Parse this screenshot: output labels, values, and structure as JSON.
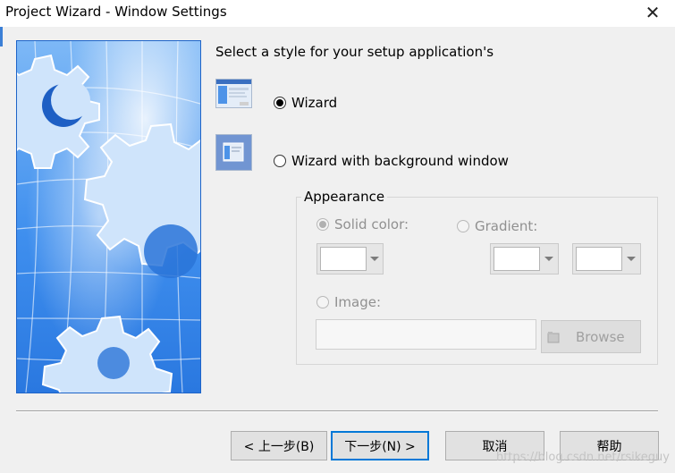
{
  "window": {
    "title": "Project Wizard - Window Settings",
    "close_glyph": "✕"
  },
  "prompt": "Select a style for your setup application's",
  "styles": [
    {
      "label": "Wizard",
      "selected": true,
      "icon": "wizard-style-thumbnail"
    },
    {
      "label": "Wizard with background window",
      "selected": false,
      "icon": "background-window-style-thumbnail"
    }
  ],
  "appearance": {
    "group_label": "Appearance",
    "solid_color": {
      "label": "Solid color:",
      "selected": true,
      "enabled": false
    },
    "gradient": {
      "label": "Gradient:",
      "selected": false,
      "enabled": false
    },
    "image": {
      "label": "Image:",
      "selected": false,
      "enabled": false,
      "value": ""
    },
    "browse_label": "Browse"
  },
  "buttons": {
    "back": "< 上一步(B)",
    "next": "下一步(N) >",
    "cancel": "取消",
    "help": "帮助"
  },
  "watermark": "https://blog.csdn.net/rsikeguy",
  "colors": {
    "accent": "#0078d7",
    "banner_blue": "#3d8ef0"
  }
}
